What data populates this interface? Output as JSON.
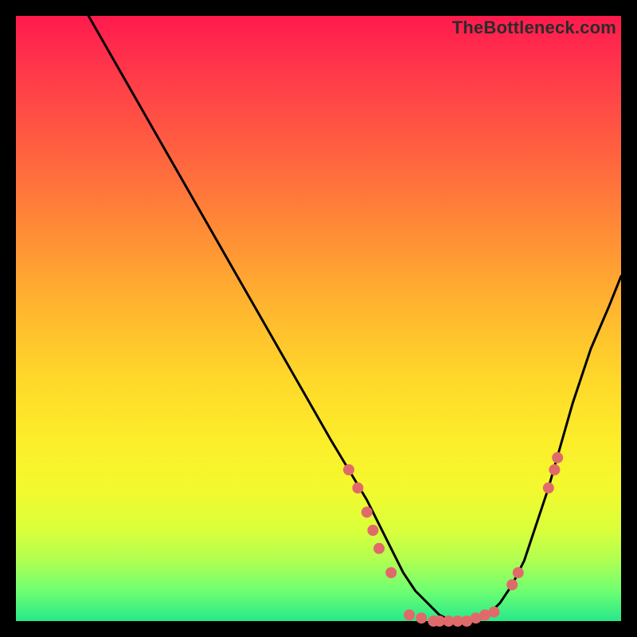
{
  "watermark": "TheBottleneck.com",
  "chart_data": {
    "type": "line",
    "title": "",
    "xlabel": "",
    "ylabel": "",
    "xlim": [
      0,
      100
    ],
    "ylim": [
      0,
      100
    ],
    "grid": false,
    "legend": false,
    "background": "red-yellow-green vertical gradient (high=red top, low=green bottom)",
    "series": [
      {
        "name": "bottleneck-curve",
        "color": "#000000",
        "x": [
          12,
          16,
          20,
          24,
          28,
          32,
          36,
          40,
          44,
          48,
          52,
          55,
          58,
          60,
          62,
          64,
          66,
          68,
          70,
          72,
          74,
          76,
          78,
          80,
          82,
          84,
          86,
          88,
          90,
          92,
          95,
          98,
          100
        ],
        "y": [
          100,
          93,
          86,
          79,
          72,
          65,
          58,
          51,
          44,
          37,
          30,
          25,
          20,
          16,
          12,
          8,
          5,
          3,
          1,
          0,
          0,
          0,
          1,
          3,
          6,
          10,
          16,
          22,
          29,
          36,
          45,
          52,
          57
        ]
      }
    ],
    "markers": [
      {
        "name": "benchmark-points",
        "color": "#e06a6a",
        "radius_px": 7,
        "points": [
          {
            "x": 55,
            "y": 25
          },
          {
            "x": 56.5,
            "y": 22
          },
          {
            "x": 58,
            "y": 18
          },
          {
            "x": 59,
            "y": 15
          },
          {
            "x": 60,
            "y": 12
          },
          {
            "x": 62,
            "y": 8
          },
          {
            "x": 65,
            "y": 1
          },
          {
            "x": 67,
            "y": 0.5
          },
          {
            "x": 69,
            "y": 0
          },
          {
            "x": 70,
            "y": 0
          },
          {
            "x": 71.5,
            "y": 0
          },
          {
            "x": 73,
            "y": 0
          },
          {
            "x": 74.5,
            "y": 0
          },
          {
            "x": 76,
            "y": 0.5
          },
          {
            "x": 77.5,
            "y": 1
          },
          {
            "x": 79,
            "y": 1.5
          },
          {
            "x": 82,
            "y": 6
          },
          {
            "x": 83,
            "y": 8
          },
          {
            "x": 88,
            "y": 22
          },
          {
            "x": 89,
            "y": 25
          },
          {
            "x": 89.5,
            "y": 27
          }
        ]
      }
    ]
  }
}
